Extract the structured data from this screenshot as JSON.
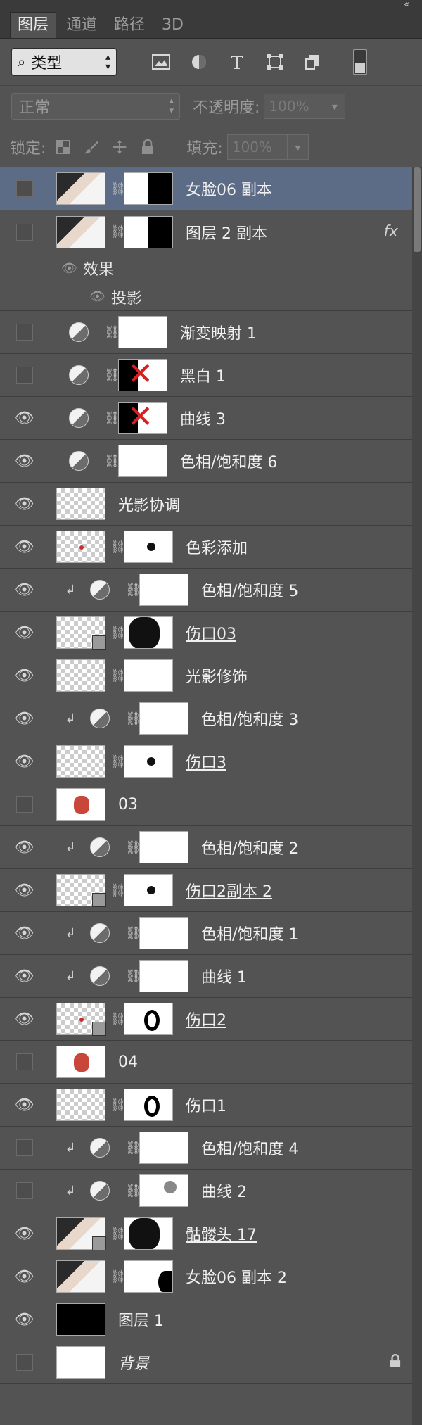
{
  "panel": {
    "collapse_icon": "«"
  },
  "tabs": [
    {
      "label": "图层",
      "active": true
    },
    {
      "label": "通道",
      "active": false
    },
    {
      "label": "路径",
      "active": false
    },
    {
      "label": "3D",
      "active": false
    }
  ],
  "filter": {
    "search_icon": "⌕",
    "kind_label": "类型",
    "icons": [
      "image-filter-icon",
      "adjustment-filter-icon",
      "type-filter-icon",
      "shape-filter-icon",
      "smart-object-filter-icon"
    ]
  },
  "blend": {
    "mode": "正常",
    "opacity_label": "不透明度:",
    "opacity_value": "100%"
  },
  "lock": {
    "label": "锁定:",
    "fill_label": "填充:",
    "fill_value": "100%"
  },
  "layers": [
    {
      "name": "女脸06 副本"
    },
    {
      "name": "图层 2 副本",
      "fx": "fx"
    },
    {
      "name": "效果"
    },
    {
      "name": "投影"
    },
    {
      "name": "渐变映射 1"
    },
    {
      "name": "黑白 1"
    },
    {
      "name": "曲线 3"
    },
    {
      "name": "色相/饱和度 6"
    },
    {
      "name": "光影协调"
    },
    {
      "name": "色彩添加"
    },
    {
      "name": "色相/饱和度 5"
    },
    {
      "name": "伤口03"
    },
    {
      "name": "光影修饰"
    },
    {
      "name": "色相/饱和度 3"
    },
    {
      "name": "伤口3"
    },
    {
      "name": "03"
    },
    {
      "name": "色相/饱和度 2"
    },
    {
      "name": "伤口2副本 2"
    },
    {
      "name": "色相/饱和度 1"
    },
    {
      "name": "曲线 1"
    },
    {
      "name": "伤口2"
    },
    {
      "name": "04"
    },
    {
      "name": "伤口1"
    },
    {
      "name": "色相/饱和度 4"
    },
    {
      "name": "曲线 2"
    },
    {
      "name": "骷髅头 17"
    },
    {
      "name": "女脸06 副本 2"
    },
    {
      "name": "图层 1"
    },
    {
      "name": "背景"
    }
  ],
  "colors": {
    "panel_bg": "#535353",
    "selected_row": "#5c6b86",
    "tab_bar": "#3a3a3a"
  }
}
